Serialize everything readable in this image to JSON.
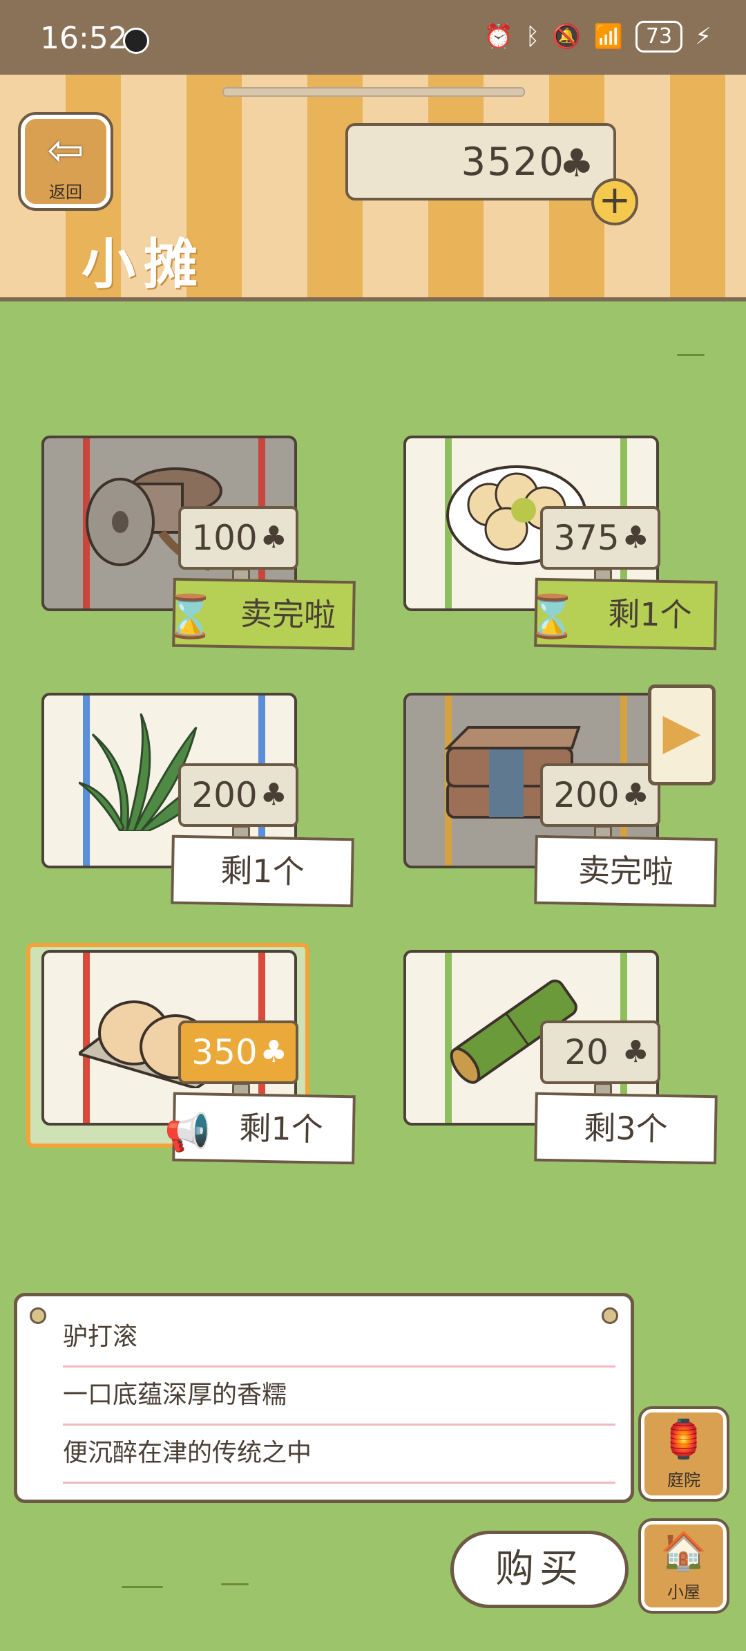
{
  "status_bar": {
    "time": "16:52",
    "battery": "73"
  },
  "header": {
    "back_label": "返回",
    "title": "小摊",
    "currency_amount": "3520",
    "currency_icon": "clover-icon"
  },
  "items": [
    {
      "price": "100",
      "status": "卖完啦"
    },
    {
      "price": "375",
      "status": "剩1个"
    },
    {
      "price": "200",
      "status": "剩1个"
    },
    {
      "price": "200",
      "status": "卖完啦"
    },
    {
      "price": "350",
      "status": "剩1个"
    },
    {
      "price": "20",
      "status": "剩3个"
    }
  ],
  "description": {
    "name": "驴打滚",
    "line1": "一口底蕴深厚的香糯",
    "line2": "便沉醉在津的传统之中"
  },
  "side_buttons": {
    "yard": "庭院",
    "house": "小屋"
  },
  "buy_label": "购买",
  "colors": {
    "grass": "#9cc46a",
    "highlight": "#eba93a",
    "accent_green": "#b6cf55"
  }
}
